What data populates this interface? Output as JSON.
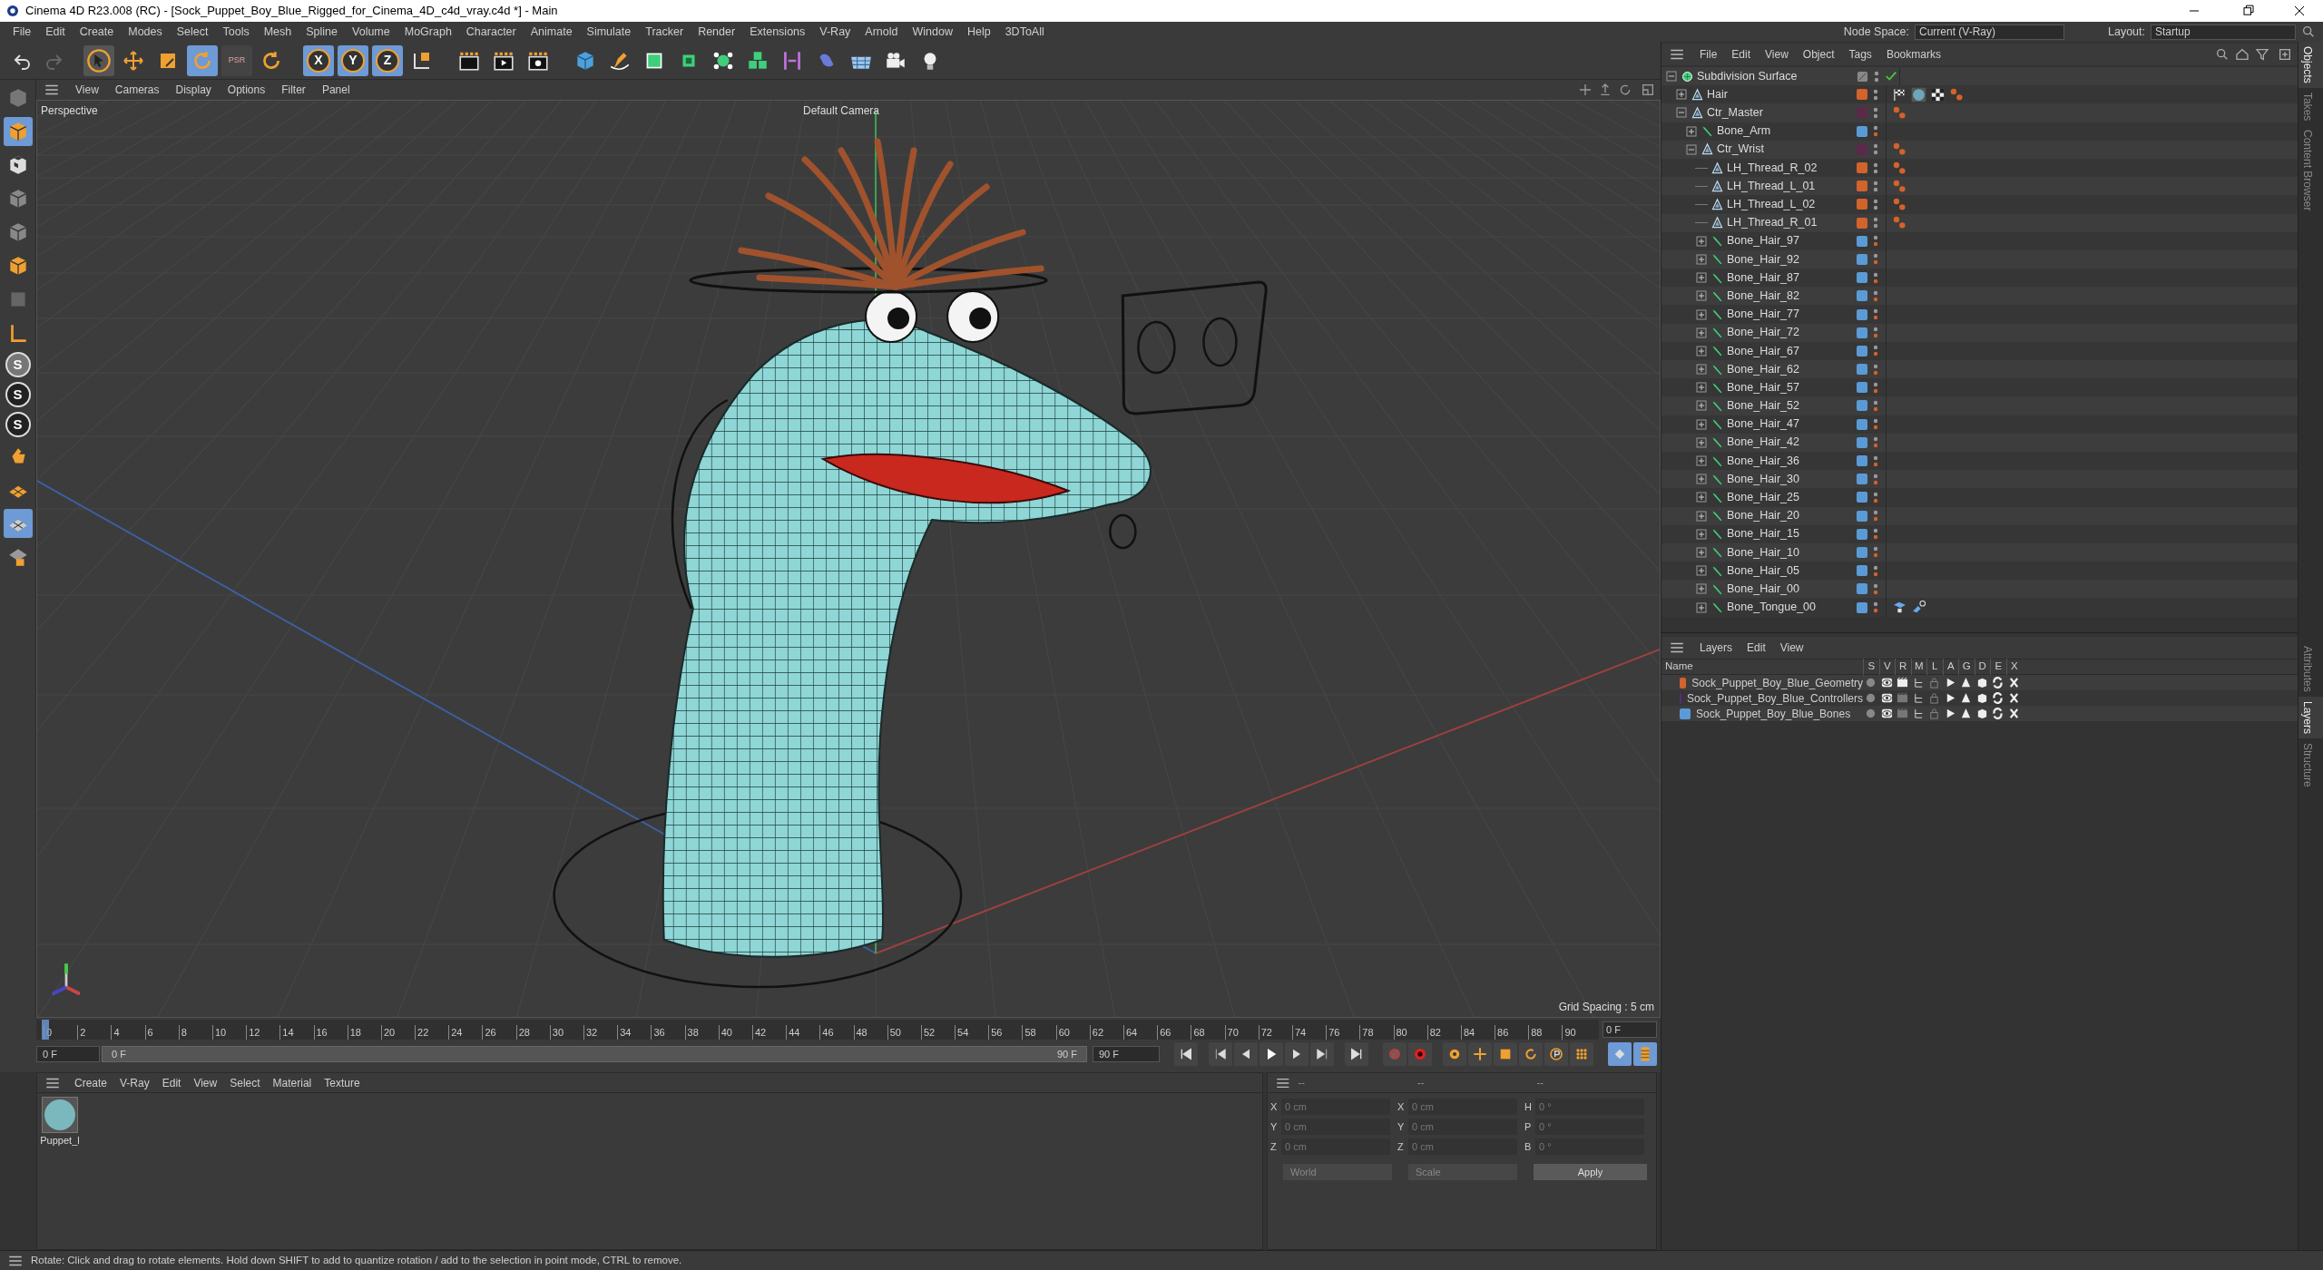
{
  "window": {
    "title": "Cinema 4D R23.008 (RC) - [Sock_Puppet_Boy_Blue_Rigged_for_Cinema_4D_c4d_vray.c4d *] - Main"
  },
  "menu_bar": [
    "File",
    "Edit",
    "Create",
    "Modes",
    "Select",
    "Tools",
    "Mesh",
    "Spline",
    "Volume",
    "MoGraph",
    "Character",
    "Animate",
    "Simulate",
    "Tracker",
    "Render",
    "Extensions",
    "V-Ray",
    "Arnold",
    "Window",
    "Help",
    "3DToAll"
  ],
  "node_space": {
    "label": "Node Space:",
    "value": "Current (V-Ray)"
  },
  "layout": {
    "label": "Layout:",
    "value": "Startup"
  },
  "toolbar": {
    "psr_label": "PSR",
    "axis_buttons": [
      {
        "label": "X",
        "selected": true
      },
      {
        "label": "Y",
        "selected": true
      },
      {
        "label": "Z",
        "selected": true
      }
    ]
  },
  "left_toolbar": {
    "snap_labels": [
      "S",
      "S",
      "S"
    ]
  },
  "viewport": {
    "menu": [
      "View",
      "Cameras",
      "Display",
      "Options",
      "Filter",
      "Panel"
    ],
    "view_label": "Perspective",
    "camera_label": "Default Camera",
    "grid_spacing": "Grid Spacing : 5 cm"
  },
  "objects": {
    "menu": [
      "File",
      "Edit",
      "View",
      "Object",
      "Tags",
      "Bookmarks"
    ],
    "rows": [
      {
        "name": "Subdivision Surface",
        "kind": "subdivision",
        "expanded": true,
        "enabled": true,
        "children": [
          {
            "name": "Hair",
            "kind": "null",
            "expanded": false,
            "color": "#d2632a",
            "tags": [
              {
                "kind": "vray"
              },
              {
                "kind": "material"
              },
              {
                "kind": "checker"
              },
              {
                "kind": "constraint"
              }
            ]
          },
          {
            "name": "Ctr_Master",
            "kind": "null",
            "expanded": true,
            "color": "#5a2a4a",
            "tags": [
              {
                "kind": "constraint"
              }
            ],
            "children": [
              {
                "name": "Bone_Arm",
                "kind": "bone",
                "expanded": false,
                "color": "#5b9bd5"
              },
              {
                "name": "Ctr_Wrist",
                "kind": "null",
                "expanded": true,
                "color": "#5a2a4a",
                "tags": [
                  {
                    "kind": "constraint"
                  }
                ],
                "children": [
                  {
                    "name": "LH_Thread_R_02",
                    "kind": "null",
                    "color": "#d2632a",
                    "tags": [
                      {
                        "kind": "constraint"
                      }
                    ]
                  },
                  {
                    "name": "LH_Thread_L_01",
                    "kind": "null",
                    "color": "#d2632a",
                    "tags": [
                      {
                        "kind": "constraint"
                      }
                    ]
                  },
                  {
                    "name": "LH_Thread_L_02",
                    "kind": "null",
                    "color": "#d2632a",
                    "tags": [
                      {
                        "kind": "constraint"
                      }
                    ]
                  },
                  {
                    "name": "LH_Thread_R_01",
                    "kind": "null",
                    "color": "#d2632a",
                    "tags": [
                      {
                        "kind": "constraint"
                      }
                    ]
                  },
                  {
                    "name": "Bone_Hair_97",
                    "kind": "bone",
                    "expanded": false,
                    "color": "#5b9bd5"
                  },
                  {
                    "name": "Bone_Hair_92",
                    "kind": "bone",
                    "expanded": false,
                    "color": "#5b9bd5"
                  },
                  {
                    "name": "Bone_Hair_87",
                    "kind": "bone",
                    "expanded": false,
                    "color": "#5b9bd5"
                  },
                  {
                    "name": "Bone_Hair_82",
                    "kind": "bone",
                    "expanded": false,
                    "color": "#5b9bd5"
                  },
                  {
                    "name": "Bone_Hair_77",
                    "kind": "bone",
                    "expanded": false,
                    "color": "#5b9bd5"
                  },
                  {
                    "name": "Bone_Hair_72",
                    "kind": "bone",
                    "expanded": false,
                    "color": "#5b9bd5"
                  },
                  {
                    "name": "Bone_Hair_67",
                    "kind": "bone",
                    "expanded": false,
                    "color": "#5b9bd5"
                  },
                  {
                    "name": "Bone_Hair_62",
                    "kind": "bone",
                    "expanded": false,
                    "color": "#5b9bd5"
                  },
                  {
                    "name": "Bone_Hair_57",
                    "kind": "bone",
                    "expanded": false,
                    "color": "#5b9bd5"
                  },
                  {
                    "name": "Bone_Hair_52",
                    "kind": "bone",
                    "expanded": false,
                    "color": "#5b9bd5"
                  },
                  {
                    "name": "Bone_Hair_47",
                    "kind": "bone",
                    "expanded": false,
                    "color": "#5b9bd5"
                  },
                  {
                    "name": "Bone_Hair_42",
                    "kind": "bone",
                    "expanded": false,
                    "color": "#5b9bd5"
                  },
                  {
                    "name": "Bone_Hair_36",
                    "kind": "bone",
                    "expanded": false,
                    "color": "#5b9bd5"
                  },
                  {
                    "name": "Bone_Hair_30",
                    "kind": "bone",
                    "expanded": false,
                    "color": "#5b9bd5"
                  },
                  {
                    "name": "Bone_Hair_25",
                    "kind": "bone",
                    "expanded": false,
                    "color": "#5b9bd5"
                  },
                  {
                    "name": "Bone_Hair_20",
                    "kind": "bone",
                    "expanded": false,
                    "color": "#5b9bd5"
                  },
                  {
                    "name": "Bone_Hair_15",
                    "kind": "bone",
                    "expanded": false,
                    "color": "#5b9bd5"
                  },
                  {
                    "name": "Bone_Hair_10",
                    "kind": "bone",
                    "expanded": false,
                    "color": "#5b9bd5"
                  },
                  {
                    "name": "Bone_Hair_05",
                    "kind": "bone",
                    "expanded": false,
                    "color": "#5b9bd5"
                  },
                  {
                    "name": "Bone_Hair_00",
                    "kind": "bone",
                    "expanded": false,
                    "color": "#5b9bd5"
                  },
                  {
                    "name": "Bone_Tongue_00",
                    "kind": "bone",
                    "expanded": false,
                    "color": "#5b9bd5",
                    "tags": [
                      {
                        "kind": "ik"
                      },
                      {
                        "kind": "ik_goal"
                      }
                    ]
                  }
                ]
              }
            ]
          }
        ]
      }
    ]
  },
  "side_tabs_top": [
    {
      "label": "Objects",
      "selected": true
    },
    {
      "label": "Takes",
      "selected": false
    },
    {
      "label": "Content Browser",
      "selected": false
    }
  ],
  "side_tabs_bottom": [
    {
      "label": "Attributes",
      "selected": false
    },
    {
      "label": "Layers",
      "selected": true
    },
    {
      "label": "Structure",
      "selected": false
    }
  ],
  "layers": {
    "menu": [
      "Layers",
      "Edit",
      "View"
    ],
    "columns": [
      "Name",
      "S",
      "V",
      "R",
      "M",
      "L",
      "A",
      "G",
      "D",
      "E",
      "X"
    ],
    "rows": [
      {
        "name": "Sock_Puppet_Boy_Blue_Geometry",
        "color": "#d2632a",
        "render": true
      },
      {
        "name": "Sock_Puppet_Boy_Blue_Controllers",
        "color": "#5a2a78",
        "render": false
      },
      {
        "name": "Sock_Puppet_Boy_Blue_Bones",
        "color": "#5b9bd5",
        "render": false
      }
    ]
  },
  "timeline": {
    "ticks": [
      "0",
      "2",
      "4",
      "6",
      "8",
      "10",
      "12",
      "14",
      "16",
      "18",
      "20",
      "22",
      "24",
      "26",
      "28",
      "30",
      "32",
      "34",
      "36",
      "38",
      "40",
      "42",
      "44",
      "46",
      "48",
      "50",
      "52",
      "54",
      "56",
      "58",
      "60",
      "62",
      "64",
      "66",
      "68",
      "70",
      "72",
      "74",
      "76",
      "78",
      "80",
      "82",
      "84",
      "86",
      "88",
      "90"
    ],
    "level": 0,
    "current_frame": "0 F",
    "start_field": "0 F",
    "range_slider": {
      "start": "0 F",
      "end": "90 F",
      "level": 1
    },
    "end_field": "90 F"
  },
  "materials": {
    "menu": [
      "Create",
      "V-Ray",
      "Edit",
      "View",
      "Select",
      "Material",
      "Texture"
    ],
    "items": [
      {
        "name": "Puppet_l"
      }
    ]
  },
  "coordinates": {
    "headers": [
      "--",
      "--",
      "--"
    ],
    "rows": [
      [
        {
          "label": "X",
          "value": "0 cm"
        },
        {
          "label": "X",
          "value": "0 cm"
        },
        {
          "label": "H",
          "value": "0 °"
        }
      ],
      [
        {
          "label": "Y",
          "value": "0 cm"
        },
        {
          "label": "Y",
          "value": "0 cm"
        },
        {
          "label": "P",
          "value": "0 °"
        }
      ],
      [
        {
          "label": "Z",
          "value": "0 cm"
        },
        {
          "label": "Z",
          "value": "0 cm"
        },
        {
          "label": "B",
          "value": "0 °"
        }
      ]
    ],
    "space": "World",
    "mode": "Scale",
    "apply": "Apply"
  },
  "status_bar": "Rotate: Click and drag to rotate elements. Hold down SHIFT to add to quantize rotation / add to the selection in point mode, CTRL to remove."
}
